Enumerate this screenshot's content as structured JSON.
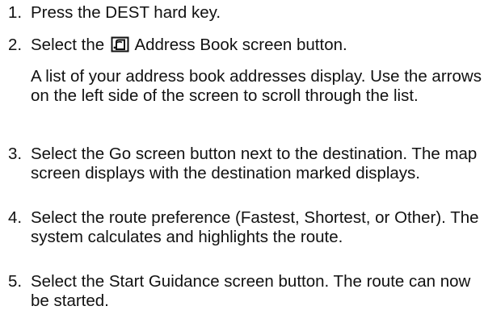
{
  "steps": [
    {
      "number": "1.",
      "text": "Press the DEST hard key."
    },
    {
      "number": "2.",
      "text_before": "Select the",
      "icon": "address-book-icon",
      "text_after": "Address Book screen button."
    },
    {
      "number": "3.",
      "text": "Select the Go screen button next to the destination. The map screen displays with the destination marked displays."
    },
    {
      "number": "4.",
      "text": "Select the route preference (Fastest, Shortest, or Other). The system calculates and highlights the route."
    },
    {
      "number": "5.",
      "text": "Select the Start Guidance screen button. The route can now be started."
    }
  ],
  "note": "A list of your address book addresses display. Use the arrows on the left side of the screen to scroll through the list."
}
